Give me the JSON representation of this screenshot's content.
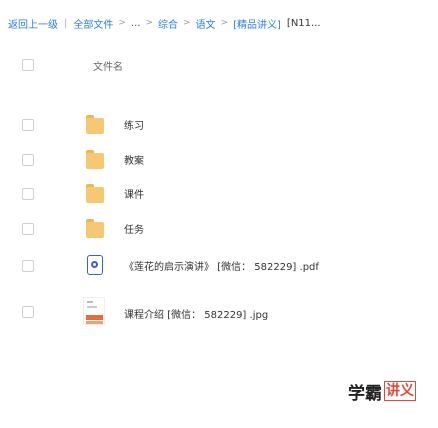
{
  "breadcrumb": {
    "back": "返回上一级",
    "root": "全部文件",
    "ellipsis": "...",
    "items": [
      "综合",
      "语文"
    ],
    "current": "[精品讲义]",
    "tail": "[N11..."
  },
  "header": {
    "name_label": "文件名"
  },
  "files": [
    {
      "type": "folder",
      "name": "练习"
    },
    {
      "type": "folder",
      "name": "教案"
    },
    {
      "type": "folder",
      "name": "课件"
    },
    {
      "type": "folder",
      "name": "任务"
    },
    {
      "type": "pdf",
      "name": "《莲花的启示演讲》  [微信： 582229] .pdf"
    },
    {
      "type": "jpg",
      "name": "课程介绍 [微信： 582229] .jpg"
    }
  ],
  "footer": {
    "logo_text": "学霸",
    "logo_mark": "讲义"
  },
  "colors": {
    "link": "#2b7de9",
    "folder": "#f7c873",
    "pdf": "#3b5bdb",
    "logo_accent": "#e04a3a"
  }
}
